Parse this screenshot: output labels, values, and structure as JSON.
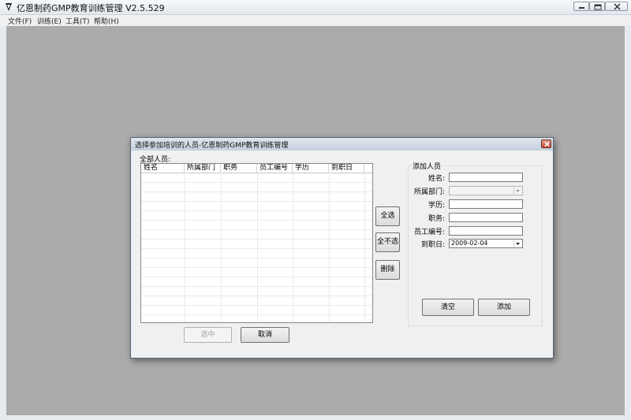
{
  "window": {
    "title": "亿恩制药GMP教育训练管理 V2.5.529",
    "menu": [
      "文件(F)",
      "训练(E)",
      "工具(T)",
      "帮助(H)"
    ]
  },
  "dialog": {
    "title": "选择参加培训的人员-亿恩制药GMP教育训练管理",
    "all_personnel_label": "全部人员:",
    "columns": [
      "姓名",
      "所属部门",
      "职务",
      "员工编号",
      "学历",
      "到职日"
    ],
    "buttons": {
      "select_all": "全选",
      "deselect_all": "全不选",
      "delete": "删除",
      "select": "选中",
      "cancel": "取消"
    },
    "add_group": {
      "caption": "添加人员",
      "name_label": "姓名:",
      "dept_label": "所属部门:",
      "edu_label": "学历:",
      "job_label": "职务:",
      "empno_label": "员工编号:",
      "date_label": "到职日:",
      "date_value": "2009-02-04",
      "clear_button": "清空",
      "add_button": "添加"
    }
  },
  "colors": {
    "workspace": "#ababab",
    "dialog_bg": "#f0f0f0",
    "close_red": "#c8473a"
  }
}
